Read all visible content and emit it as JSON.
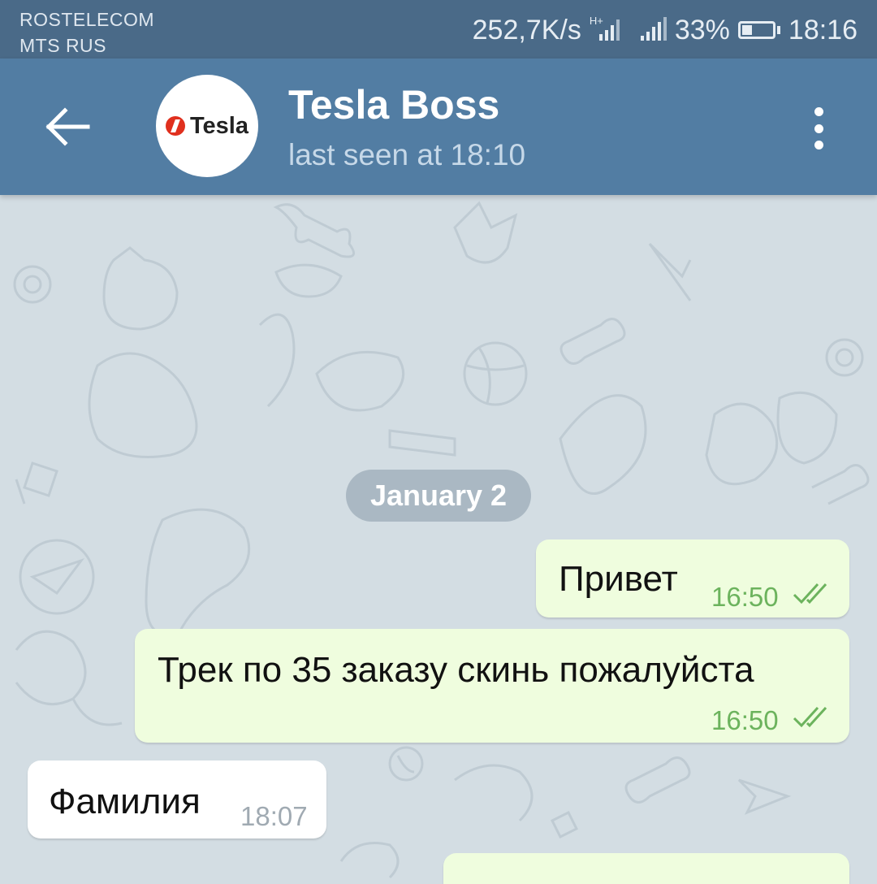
{
  "status_bar": {
    "carrier_1": "ROSTELECOM",
    "carrier_2": "MTS RUS",
    "speed": "252,7K/s",
    "network_type": "H+",
    "battery": "33%",
    "time": "18:16"
  },
  "header": {
    "title": "Tesla Boss",
    "subtitle": "last seen at 18:10",
    "avatar_logo_text": "Tesla",
    "back_icon": "arrow-left-icon",
    "menu_icon": "more-vertical-icon"
  },
  "chat": {
    "date_label": "January 2",
    "messages": [
      {
        "direction": "out",
        "text": "Привет",
        "time": "16:50",
        "status": "read"
      },
      {
        "direction": "out",
        "text": "Трек по 35 заказу скинь пожалуйста",
        "time": "16:50",
        "status": "read"
      },
      {
        "direction": "in",
        "text": "Фамилия",
        "time": "18:07"
      }
    ]
  },
  "colors": {
    "status_bar": "#4a6a88",
    "header": "#527da3",
    "outgoing_bubble": "#effdde",
    "incoming_bubble": "#ffffff",
    "read_ticks": "#6cb35d",
    "chat_background": "#d3dde3"
  }
}
